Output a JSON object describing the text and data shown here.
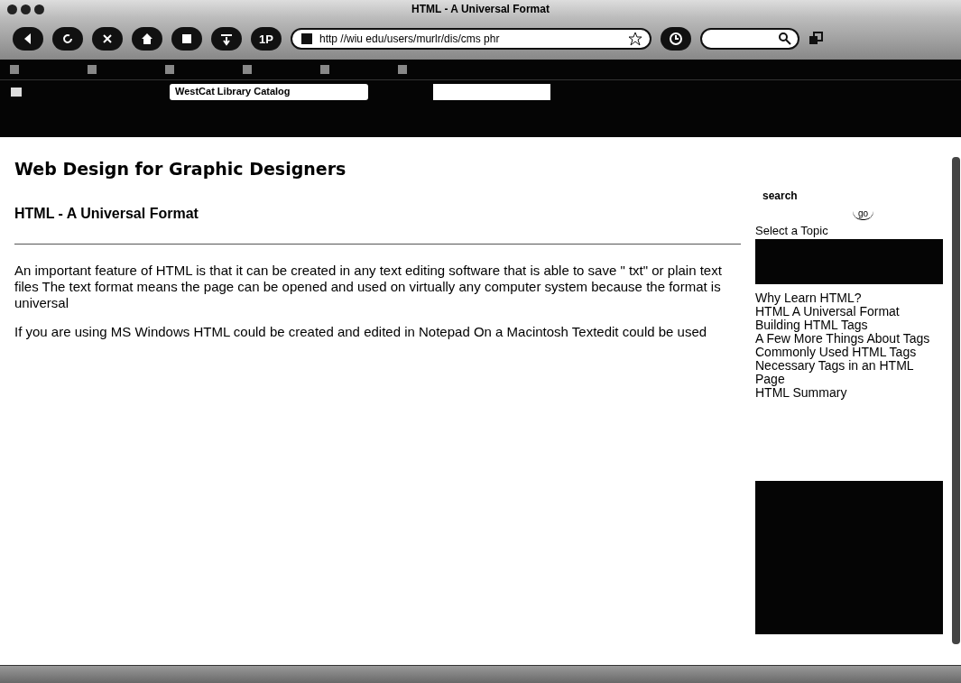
{
  "window": {
    "title": "HTML - A Universal Format"
  },
  "toolbar": {
    "badge_button": "1P",
    "url": "http //wiu edu/users/murlr/dis/cms phr"
  },
  "search_toolbar": {
    "catalog_field": "WestCat Library Catalog"
  },
  "page": {
    "site_title": "Web Design for Graphic Designers",
    "heading": "HTML - A Universal Format",
    "paragraphs": [
      "An important feature of HTML is that it can be created in any text editing software that is able to save \" txt\" or plain text files  The text format means the page can be opened and used on virtually any computer system because the format is universal",
      "If you are using MS Windows  HTML could be created and edited in Notepad  On a Macintosh Textedit could be used"
    ]
  },
  "sidebar": {
    "search_label": "search",
    "go_button": "go",
    "topic_label": "Select a Topic",
    "topics": [
      "Why Learn HTML?",
      "HTML   A Universal Format",
      "Building HTML Tags",
      "A Few More Things About Tags",
      "Commonly Used HTML Tags",
      "Necessary Tags in an HTML Page",
      "HTML Summary"
    ]
  }
}
